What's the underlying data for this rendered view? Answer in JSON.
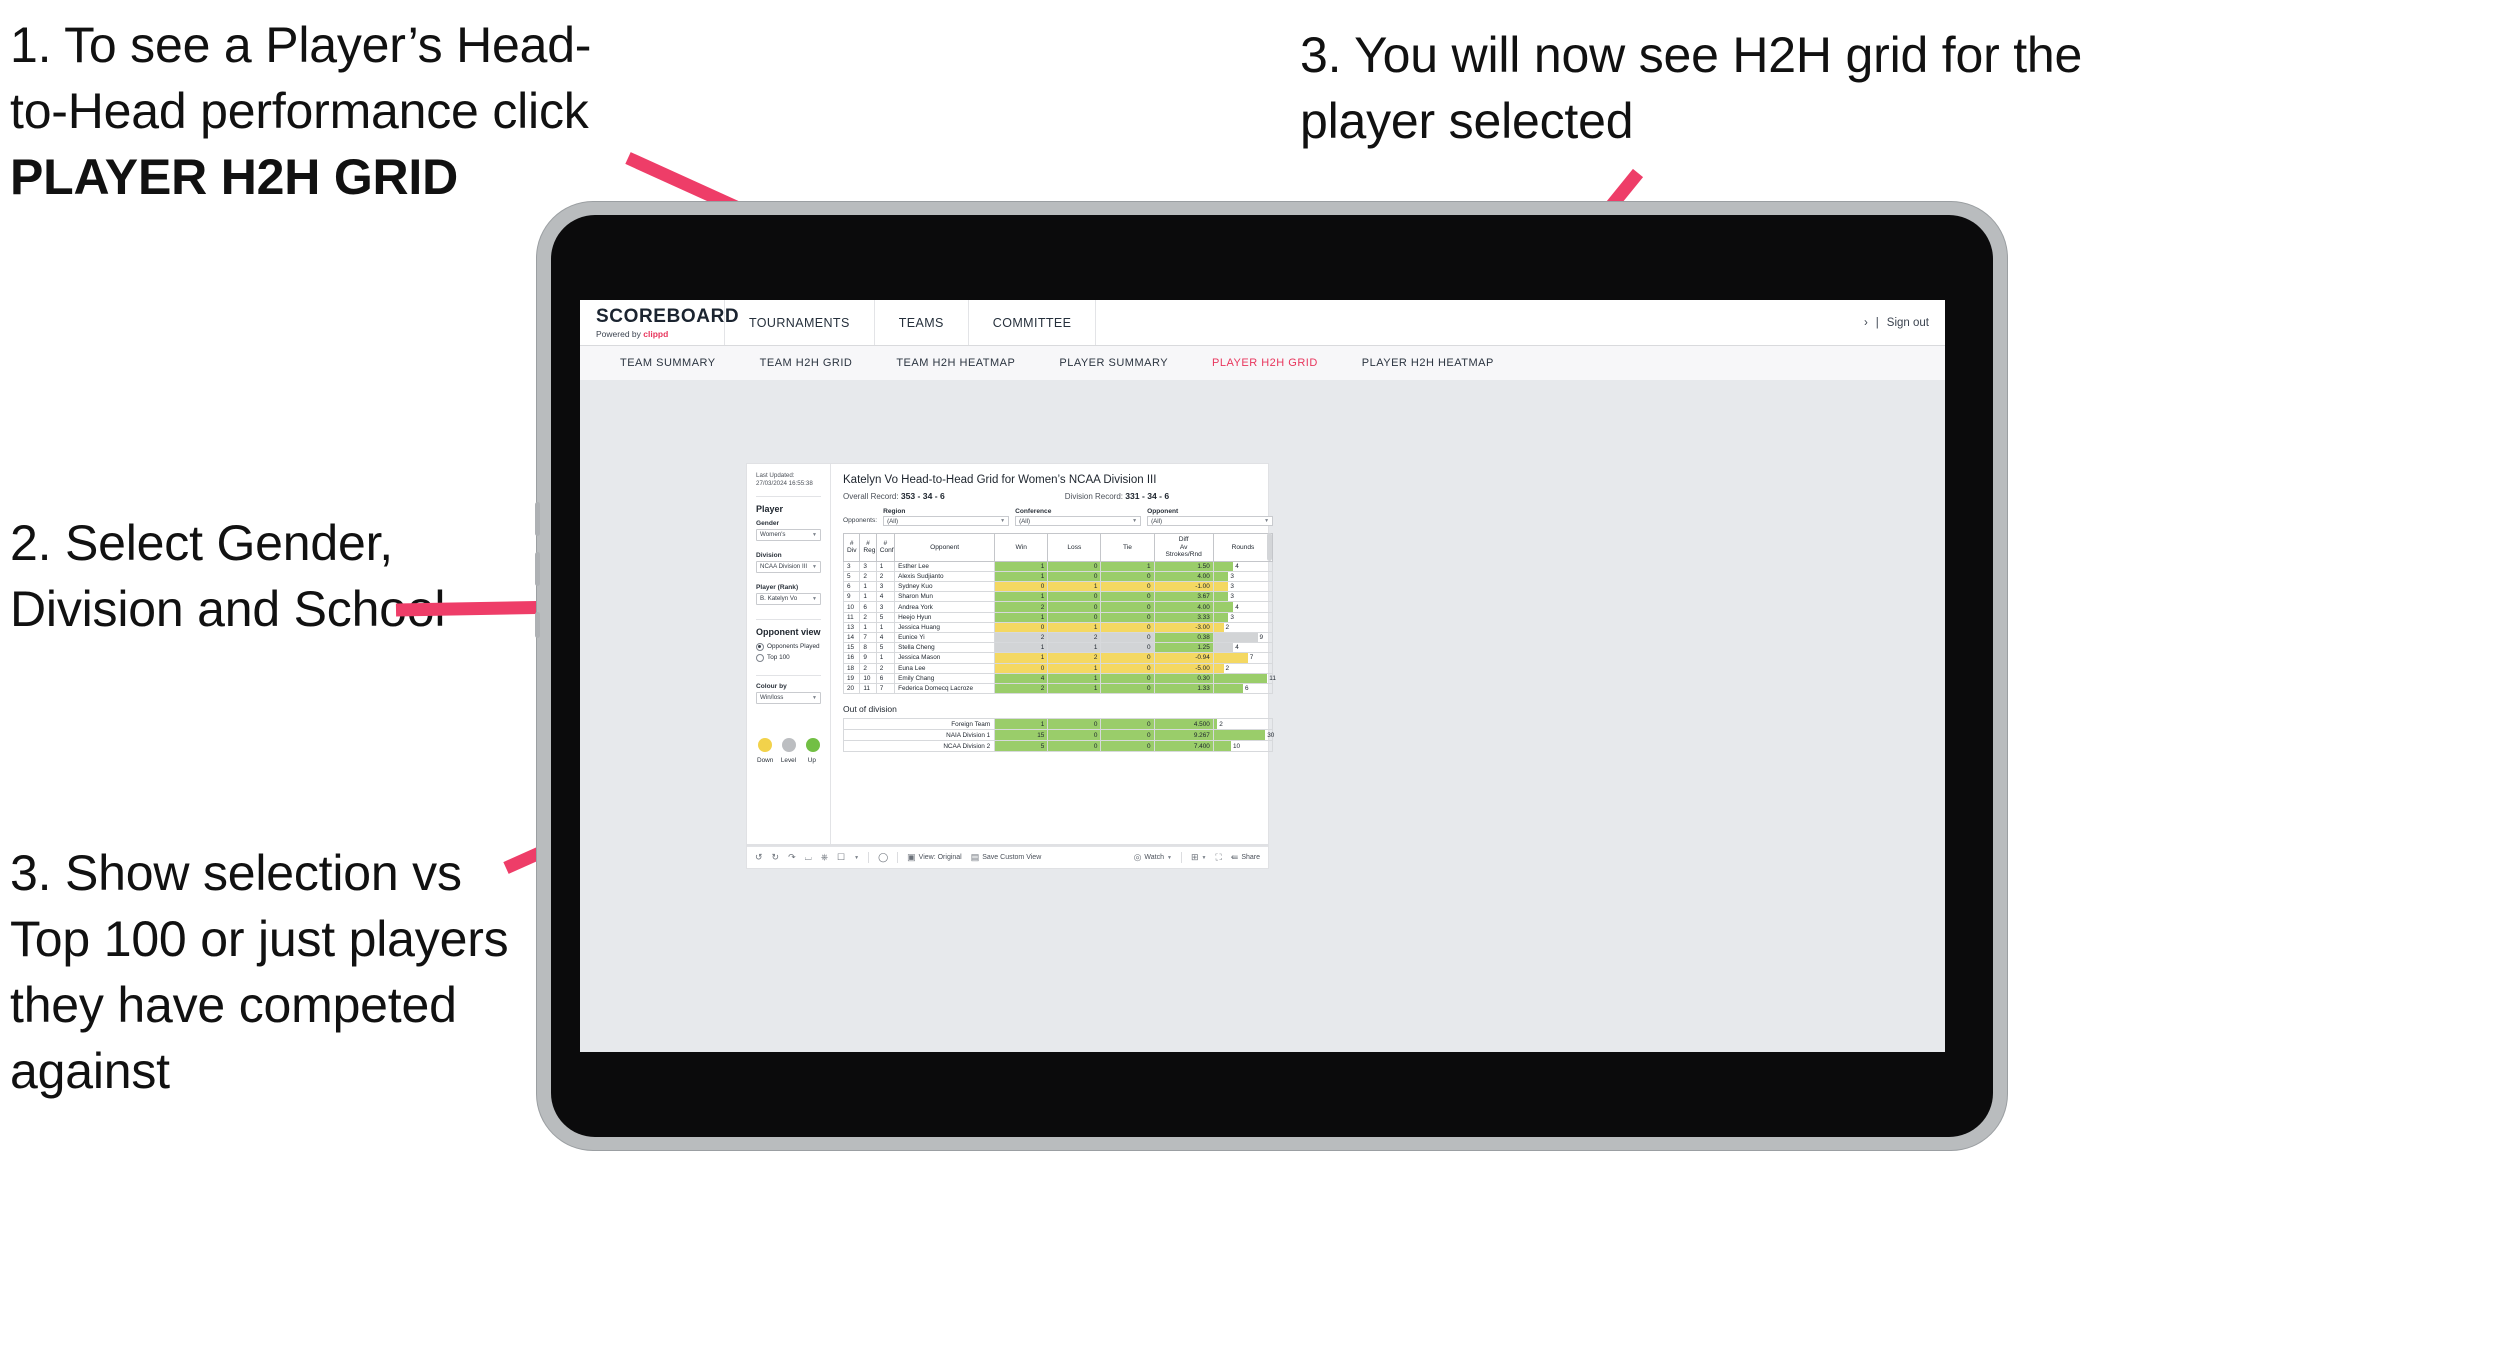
{
  "annotations": {
    "a1_line1": "1. To see a Player’s Head-",
    "a1_line2": "to-Head performance click",
    "a1_strong": "PLAYER H2H GRID",
    "a2": "2. Select Gender, Division and School",
    "a3": "3. Show selection vs Top 100 or just players they have competed against",
    "a4": "3. You will now see H2H grid for the player selected",
    "arrow_color": "#ee3d68"
  },
  "app": {
    "brand": {
      "name": "SCOREBOARD",
      "powered_prefix": "Powered by ",
      "powered_brand": "clippd"
    },
    "topnav": [
      "TOURNAMENTS",
      "TEAMS",
      "COMMITTEE"
    ],
    "topright": {
      "divider": "|",
      "signout": "Sign out"
    },
    "subnav": {
      "tabs": [
        "TEAM SUMMARY",
        "TEAM H2H GRID",
        "TEAM H2H HEATMAP",
        "PLAYER SUMMARY",
        "PLAYER H2H GRID",
        "PLAYER H2H HEATMAP"
      ],
      "active": "PLAYER H2H GRID",
      "active_color": "#e8365d"
    }
  },
  "sidebar": {
    "last_updated": "Last Updated: 27/03/2024 16:55:38",
    "player_section_title": "Player",
    "filters": [
      {
        "label": "Gender",
        "value": "Women's"
      },
      {
        "label": "Division",
        "value": "NCAA Division III"
      },
      {
        "label": "Player (Rank)",
        "value": "B. Katelyn Vo"
      }
    ],
    "opponent_view": {
      "title": "Opponent view",
      "options": [
        {
          "label": "Opponents Played",
          "selected": true
        },
        {
          "label": "Top 100",
          "selected": false
        }
      ]
    },
    "colour_by": {
      "label": "Colour by",
      "value": "Win/loss"
    },
    "legend": [
      {
        "label": "Down",
        "color": "#f2d24b"
      },
      {
        "label": "Level",
        "color": "#bcbec1"
      },
      {
        "label": "Up",
        "color": "#72bf44"
      }
    ]
  },
  "main": {
    "title": "Katelyn Vo Head-to-Head Grid for Women’s NCAA Division III",
    "overall_record_label": "Overall Record:",
    "overall_record": "353 -  34 - 6",
    "division_record_label": "Division Record:",
    "division_record": "331 -  34 - 6",
    "opponents_label": "Opponents:",
    "opponent_filters": [
      {
        "label": "Region",
        "value": "(All)"
      },
      {
        "label": "Conference",
        "value": "(All)"
      },
      {
        "label": "Opponent",
        "value": "(All)"
      }
    ],
    "columns": [
      "# Div",
      "# Reg",
      "# Conf",
      "Opponent",
      "Win",
      "Loss",
      "Tie",
      "Diff Av Strokes/Rnd",
      "Rounds"
    ],
    "rows": [
      {
        "div": "3",
        "reg": "3",
        "conf": "1",
        "opponent": "Esther Lee",
        "win": "1",
        "loss": "0",
        "tie": "1",
        "diff": "1.50",
        "rounds": "4",
        "color": "#9acd6a"
      },
      {
        "div": "5",
        "reg": "2",
        "conf": "2",
        "opponent": "Alexis Sudjianto",
        "win": "1",
        "loss": "0",
        "tie": "0",
        "diff": "4.00",
        "rounds": "3",
        "color": "#9acd6a"
      },
      {
        "div": "6",
        "reg": "1",
        "conf": "3",
        "opponent": "Sydney Kuo",
        "win": "0",
        "loss": "1",
        "tie": "0",
        "diff": "-1.00",
        "rounds": "3",
        "color": "#f4d862"
      },
      {
        "div": "9",
        "reg": "1",
        "conf": "4",
        "opponent": "Sharon Mun",
        "win": "1",
        "loss": "0",
        "tie": "0",
        "diff": "3.67",
        "rounds": "3",
        "color": "#9acd6a"
      },
      {
        "div": "10",
        "reg": "6",
        "conf": "3",
        "opponent": "Andrea York",
        "win": "2",
        "loss": "0",
        "tie": "0",
        "diff": "4.00",
        "rounds": "4",
        "color": "#9acd6a"
      },
      {
        "div": "11",
        "reg": "2",
        "conf": "5",
        "opponent": "Heejo Hyun",
        "win": "1",
        "loss": "0",
        "tie": "0",
        "diff": "3.33",
        "rounds": "3",
        "color": "#9acd6a"
      },
      {
        "div": "13",
        "reg": "1",
        "conf": "1",
        "opponent": "Jessica Huang",
        "win": "0",
        "loss": "1",
        "tie": "0",
        "diff": "-3.00",
        "rounds": "2",
        "color": "#f4d862"
      },
      {
        "div": "14",
        "reg": "7",
        "conf": "4",
        "opponent": "Eunice Yi",
        "win": "2",
        "loss": "2",
        "tie": "0",
        "diff": "0.38",
        "rounds": "9",
        "color": "#d2d4d6",
        "diff_color": "#9acd6a"
      },
      {
        "div": "15",
        "reg": "8",
        "conf": "5",
        "opponent": "Stella Cheng",
        "win": "1",
        "loss": "1",
        "tie": "0",
        "diff": "1.25",
        "rounds": "4",
        "color": "#d2d4d6",
        "diff_color": "#9acd6a"
      },
      {
        "div": "16",
        "reg": "9",
        "conf": "1",
        "opponent": "Jessica Mason",
        "win": "1",
        "loss": "2",
        "tie": "0",
        "diff": "-0.94",
        "rounds": "7",
        "color": "#f4d862"
      },
      {
        "div": "18",
        "reg": "2",
        "conf": "2",
        "opponent": "Euna Lee",
        "win": "0",
        "loss": "1",
        "tie": "0",
        "diff": "-5.00",
        "rounds": "2",
        "color": "#f4d862"
      },
      {
        "div": "19",
        "reg": "10",
        "conf": "6",
        "opponent": "Emily Chang",
        "win": "4",
        "loss": "1",
        "tie": "0",
        "diff": "0.30",
        "rounds": "11",
        "color": "#9acd6a"
      },
      {
        "div": "20",
        "reg": "11",
        "conf": "7",
        "opponent": "Federica Domecq Lacroze",
        "win": "2",
        "loss": "1",
        "tie": "0",
        "diff": "1.33",
        "rounds": "6",
        "color": "#9acd6a"
      }
    ],
    "out_of_division": {
      "title": "Out of division",
      "rows": [
        {
          "name": "Foreign Team",
          "win": "1",
          "loss": "0",
          "tie": "0",
          "diff": "4.500",
          "rounds": "2",
          "color": "#9acd6a"
        },
        {
          "name": "NAIA Division 1",
          "win": "15",
          "loss": "0",
          "tie": "0",
          "diff": "9.267",
          "rounds": "30",
          "color": "#9acd6a"
        },
        {
          "name": "NCAA Division 2",
          "win": "5",
          "loss": "0",
          "tie": "0",
          "diff": "7.400",
          "rounds": "10",
          "color": "#9acd6a"
        }
      ]
    }
  },
  "toolbar": {
    "view_label": "View: Original",
    "save_label": "Save Custom View",
    "watch_label": "Watch",
    "share_label": "Share"
  },
  "chart_data": {
    "type": "table",
    "title": "Katelyn Vo Head-to-Head Grid for Women’s NCAA Division III",
    "columns": [
      "# Div",
      "# Reg",
      "# Conf",
      "Opponent",
      "Win",
      "Loss",
      "Tie",
      "Diff Av Strokes/Rnd",
      "Rounds"
    ],
    "rows": [
      [
        "3",
        "3",
        "1",
        "Esther Lee",
        "1",
        "0",
        "1",
        "1.50",
        "4"
      ],
      [
        "5",
        "2",
        "2",
        "Alexis Sudjianto",
        "1",
        "0",
        "0",
        "4.00",
        "3"
      ],
      [
        "6",
        "1",
        "3",
        "Sydney Kuo",
        "0",
        "1",
        "0",
        "-1.00",
        "3"
      ],
      [
        "9",
        "1",
        "4",
        "Sharon Mun",
        "1",
        "0",
        "0",
        "3.67",
        "3"
      ],
      [
        "10",
        "6",
        "3",
        "Andrea York",
        "2",
        "0",
        "0",
        "4.00",
        "4"
      ],
      [
        "11",
        "2",
        "5",
        "Heejo Hyun",
        "1",
        "0",
        "0",
        "3.33",
        "3"
      ],
      [
        "13",
        "1",
        "1",
        "Jessica Huang",
        "0",
        "1",
        "0",
        "-3.00",
        "2"
      ],
      [
        "14",
        "7",
        "4",
        "Eunice Yi",
        "2",
        "2",
        "0",
        "0.38",
        "9"
      ],
      [
        "15",
        "8",
        "5",
        "Stella Cheng",
        "1",
        "1",
        "0",
        "1.25",
        "4"
      ],
      [
        "16",
        "9",
        "1",
        "Jessica Mason",
        "1",
        "2",
        "0",
        "-0.94",
        "7"
      ],
      [
        "18",
        "2",
        "2",
        "Euna Lee",
        "0",
        "1",
        "0",
        "-5.00",
        "2"
      ],
      [
        "19",
        "10",
        "6",
        "Emily Chang",
        "4",
        "1",
        "0",
        "0.30",
        "11"
      ],
      [
        "20",
        "11",
        "7",
        "Federica Domecq Lacroze",
        "2",
        "1",
        "0",
        "1.33",
        "6"
      ]
    ],
    "out_of_division_rows": [
      [
        "Foreign Team",
        "1",
        "0",
        "0",
        "4.500",
        "2"
      ],
      [
        "NAIA Division 1",
        "15",
        "0",
        "0",
        "9.267",
        "30"
      ],
      [
        "NCAA Division 2",
        "5",
        "0",
        "0",
        "7.400",
        "10"
      ]
    ],
    "legend": [
      "Down",
      "Level",
      "Up"
    ],
    "colors": {
      "down": "#f2d24b",
      "level": "#bcbec1",
      "up": "#72bf44"
    }
  }
}
